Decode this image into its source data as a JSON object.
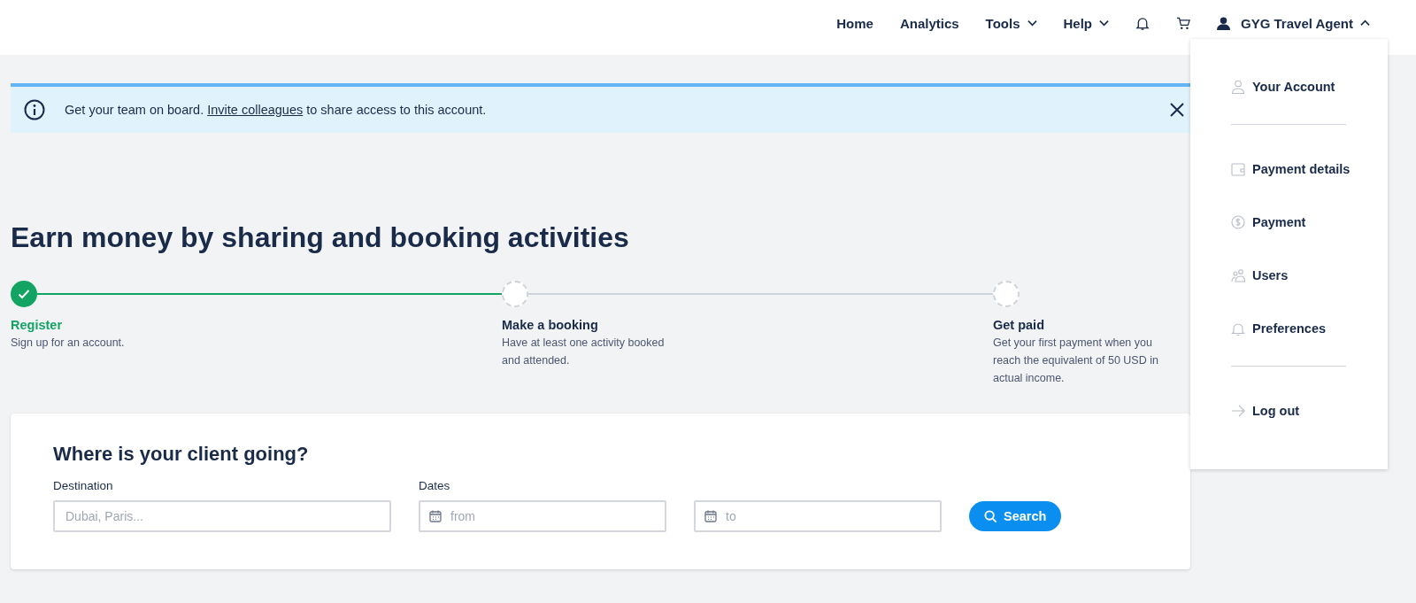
{
  "nav": {
    "items": [
      {
        "label": "Home",
        "dropdown": false
      },
      {
        "label": "Analytics",
        "dropdown": false
      },
      {
        "label": "Tools",
        "dropdown": true
      },
      {
        "label": "Help",
        "dropdown": true
      }
    ],
    "user": {
      "label": "GYG Travel Agent",
      "expanded": true
    }
  },
  "banner": {
    "before": "Get your team on board.",
    "link": "Invite colleagues",
    "after": "to share access to this account."
  },
  "heading": "Earn money by sharing and booking activities",
  "steps": [
    {
      "title": "Register",
      "text": "Sign up for an account.",
      "done": true
    },
    {
      "title": "Make a booking",
      "text": "Have at least one activity booked and attended.",
      "done": false
    },
    {
      "title": "Get paid",
      "text": "Get your first payment when you reach the equivalent of 50 USD in actual income.",
      "done": false
    }
  ],
  "search": {
    "title": "Where is your client going?",
    "destination_label": "Destination",
    "destination_placeholder": "Dubai, Paris...",
    "dates_label": "Dates",
    "from_placeholder": "from",
    "to_placeholder": "to",
    "button": "Search"
  },
  "account_menu": {
    "groups": [
      [
        {
          "label": "Your Account",
          "kind": "account"
        }
      ],
      [
        {
          "label": "Payment details",
          "kind": "wallet"
        },
        {
          "label": "Payment",
          "kind": "dollar"
        },
        {
          "label": "Users",
          "kind": "users"
        },
        {
          "label": "Preferences",
          "kind": "bell"
        }
      ],
      [
        {
          "label": "Log out",
          "kind": "logout"
        }
      ]
    ]
  }
}
